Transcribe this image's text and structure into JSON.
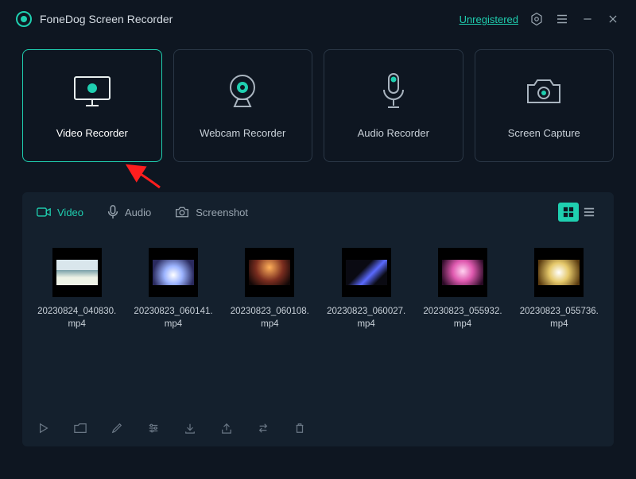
{
  "app": {
    "title": "FoneDog Screen Recorder",
    "status": "Unregistered"
  },
  "modes": [
    {
      "id": "video-recorder",
      "label": "Video Recorder"
    },
    {
      "id": "webcam-recorder",
      "label": "Webcam Recorder"
    },
    {
      "id": "audio-recorder",
      "label": "Audio Recorder"
    },
    {
      "id": "screen-capture",
      "label": "Screen Capture"
    }
  ],
  "library": {
    "tabs": {
      "video": "Video",
      "audio": "Audio",
      "screenshot": "Screenshot"
    },
    "files": [
      {
        "name": "20230824_040830.mp4"
      },
      {
        "name": "20230823_060141.mp4"
      },
      {
        "name": "20230823_060108.mp4"
      },
      {
        "name": "20230823_060027.mp4"
      },
      {
        "name": "20230823_055932.mp4"
      },
      {
        "name": "20230823_055736.mp4"
      }
    ]
  }
}
